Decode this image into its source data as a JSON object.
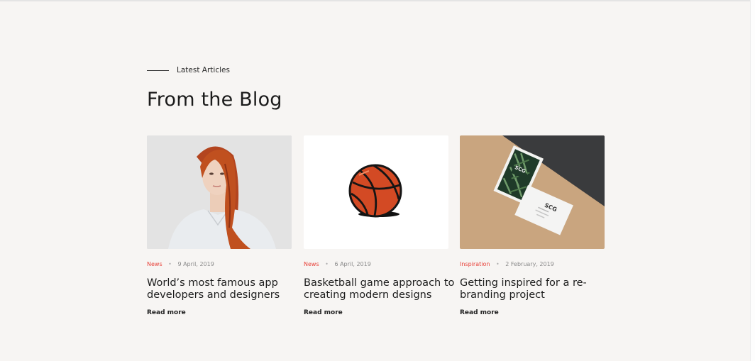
{
  "section": {
    "eyebrow": "Latest Articles",
    "heading": "From the Blog"
  },
  "colors": {
    "background": "#f7f5f3",
    "category": "#e8423a",
    "text": "#1e1e1e"
  },
  "articles": [
    {
      "image": "woman-portrait-image",
      "category": "News",
      "separator": "•",
      "date": "9 April, 2019",
      "title": "World’s most famous app developers and designers",
      "read_more": "Read more"
    },
    {
      "image": "basketball-image",
      "category": "News",
      "separator": "•",
      "date": "6 April, 2019",
      "title": "Basketball game approach to creating modern designs",
      "read_more": "Read more"
    },
    {
      "image": "business-cards-image",
      "category": "Inspiration",
      "separator": "•",
      "date": "2 February, 2019",
      "title": "Getting inspired for a re-branding project",
      "read_more": "Read more"
    }
  ]
}
